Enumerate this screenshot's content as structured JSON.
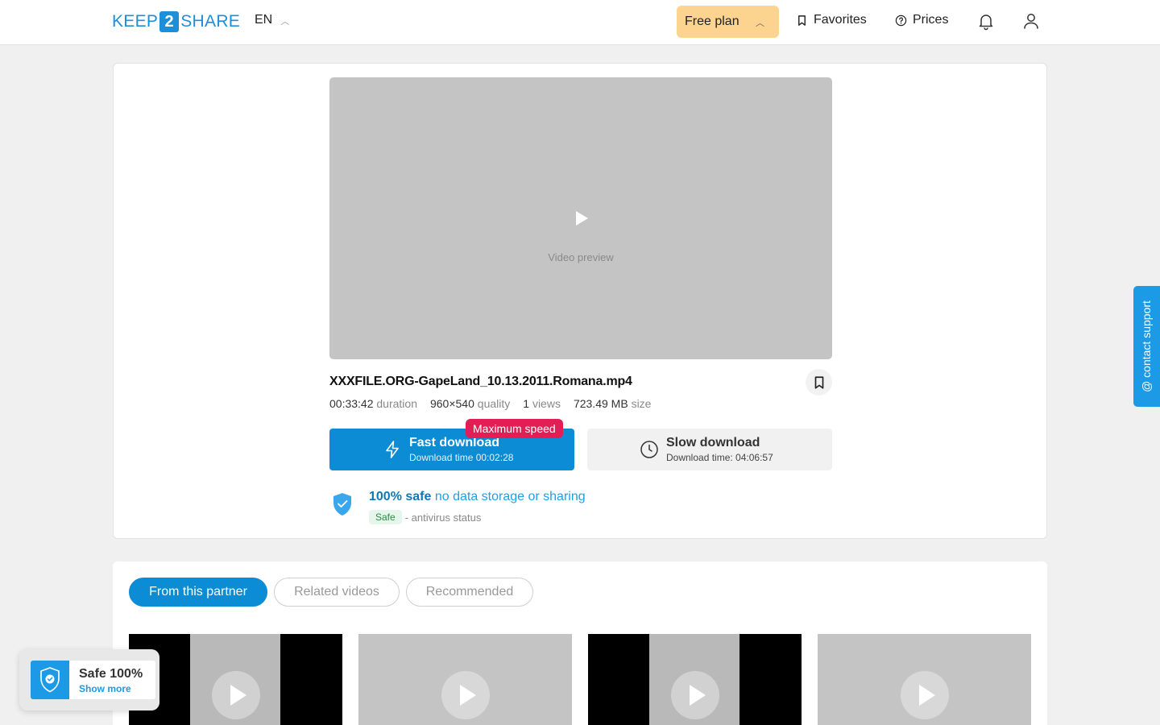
{
  "header": {
    "logo": {
      "left": "KEEP",
      "mid": "2",
      "right": "SHARE"
    },
    "lang": "EN",
    "plan_label": "Free plan",
    "favorites_label": "Favorites",
    "prices_label": "Prices"
  },
  "file": {
    "title": "XXXFILE.ORG-GapeLand_10.13.2011.Romana.mp4",
    "duration": "00:33:42",
    "duration_label": "duration",
    "quality": "960×540",
    "quality_label": "quality",
    "views": "1",
    "views_label": "views",
    "size": "723.49 MB",
    "size_label": "size"
  },
  "media": {
    "preview_label": "Video preview"
  },
  "download": {
    "fast_label": "Fast download",
    "fast_time": "Download time 00:02:28",
    "max_badge": "Maximum speed",
    "slow_label": "Slow download",
    "slow_time": "Download time: 04:06:57"
  },
  "safety": {
    "bold": "100% safe",
    "rest": "no data storage or sharing",
    "pill": "Safe",
    "status": "- antivirus status"
  },
  "support_label": "@ contact support",
  "tabs": [
    {
      "label": "From this partner",
      "active": true
    },
    {
      "label": "Related videos",
      "active": false
    },
    {
      "label": "Recommended",
      "active": false
    }
  ],
  "popup": {
    "title": "Safe 100%",
    "link": "Show more"
  },
  "colors": {
    "accent": "#0c8cd4",
    "plan": "#fcd38f",
    "badge": "#e21e55"
  }
}
